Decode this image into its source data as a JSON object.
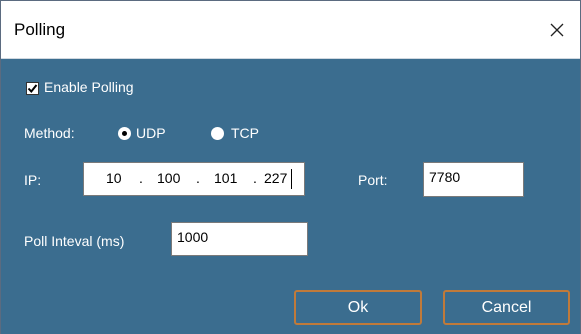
{
  "window": {
    "title": "Polling"
  },
  "enable_polling": {
    "label": "Enable Polling",
    "checked": true
  },
  "method": {
    "label": "Method:",
    "options": [
      "UDP",
      "TCP"
    ],
    "selected": "UDP"
  },
  "ip": {
    "label": "IP:",
    "octets": [
      "10",
      "100",
      "101",
      "227"
    ],
    "dot": "."
  },
  "port": {
    "label": "Port:",
    "value": "7780"
  },
  "poll_interval": {
    "label": "Poll Inteval (ms)",
    "value": "1000"
  },
  "buttons": {
    "ok": "Ok",
    "cancel": "Cancel"
  },
  "colors": {
    "client_bg": "#3b6d8f",
    "button_border": "#c07a3a"
  }
}
